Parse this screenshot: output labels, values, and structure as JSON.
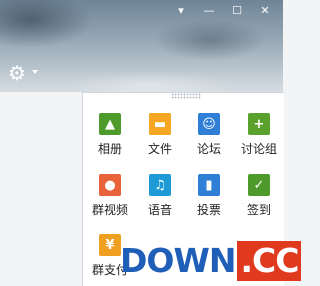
{
  "window": {
    "buttons": [
      {
        "icon": "skin-icon",
        "glyph": "▾"
      },
      {
        "icon": "minimize-icon",
        "glyph": "—"
      },
      {
        "icon": "maximize-icon",
        "glyph": "☐"
      },
      {
        "icon": "close-icon",
        "glyph": "✕"
      }
    ]
  },
  "settings": {
    "icon": "gear-icon",
    "glyph": "⚙"
  },
  "apps": [
    {
      "label": "相册",
      "icon": "photo-album-icon",
      "color": "#4e9a2a",
      "glyph": "▲"
    },
    {
      "label": "文件",
      "icon": "folder-icon",
      "color": "#f5a623",
      "glyph": "▬"
    },
    {
      "label": "论坛",
      "icon": "forum-icon",
      "color": "#2f7fd6",
      "glyph": "☺"
    },
    {
      "label": "讨论组",
      "icon": "discussion-group-icon",
      "color": "#5aa02c",
      "glyph": "+"
    },
    {
      "label": "群视频",
      "icon": "group-video-icon",
      "color": "#e8623a",
      "glyph": "●"
    },
    {
      "label": "语音",
      "icon": "voice-icon",
      "color": "#1e9ad6",
      "glyph": "♫"
    },
    {
      "label": "投票",
      "icon": "vote-icon",
      "color": "#2f7fd6",
      "glyph": "▮"
    },
    {
      "label": "签到",
      "icon": "check-in-icon",
      "color": "#4e9a2a",
      "glyph": "✓"
    },
    {
      "label": "群支付",
      "icon": "group-payment-icon",
      "color": "#f0a020",
      "glyph": "¥"
    }
  ],
  "watermark": {
    "part1": "DOWN",
    "part2": ".CC"
  }
}
